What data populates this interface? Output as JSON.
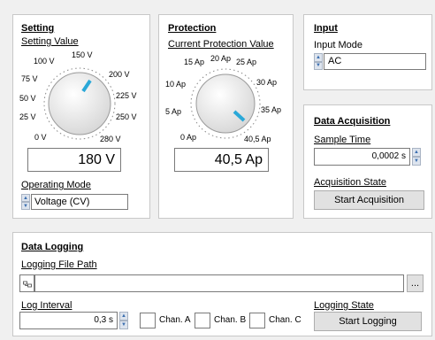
{
  "setting": {
    "title": "Setting",
    "value_label": "Setting Value",
    "knob_ticks": [
      "0 V",
      "25 V",
      "50 V",
      "75 V",
      "100 V",
      "150 V",
      "200 V",
      "225 V",
      "250 V",
      "280 V"
    ],
    "value": "180 V",
    "mode_label": "Operating Mode",
    "mode_value": "Voltage (CV)"
  },
  "protection": {
    "title": "Protection",
    "value_label": "Current Protection Value",
    "knob_ticks": [
      "0 Ap",
      "5 Ap",
      "10 Ap",
      "15 Ap",
      "20 Ap",
      "25 Ap",
      "30 Ap",
      "35 Ap",
      "40,5 Ap"
    ],
    "value": "40,5 Ap"
  },
  "input": {
    "title": "Input",
    "mode_label": "Input Mode",
    "mode_value": "AC"
  },
  "acquisition": {
    "title": "Data Acquisition",
    "sample_time_label": "Sample Time",
    "sample_time_value": "0,0002 s",
    "state_label": "Acquisition State",
    "start_button": "Start Acquisition"
  },
  "logging": {
    "title": "Data Logging",
    "path_label": "Logging File Path",
    "path_value": "",
    "browse_button": "...",
    "interval_label": "Log Interval",
    "interval_value": "0,3 s",
    "channels": [
      "Chan. A",
      "Chan. B",
      "Chan. C"
    ],
    "state_label": "Logging State",
    "start_button": "Start Logging"
  },
  "colors": {
    "needle": "#2aa8d8",
    "panel_bg": "#ffffff",
    "window_bg": "#f0f0f0"
  }
}
